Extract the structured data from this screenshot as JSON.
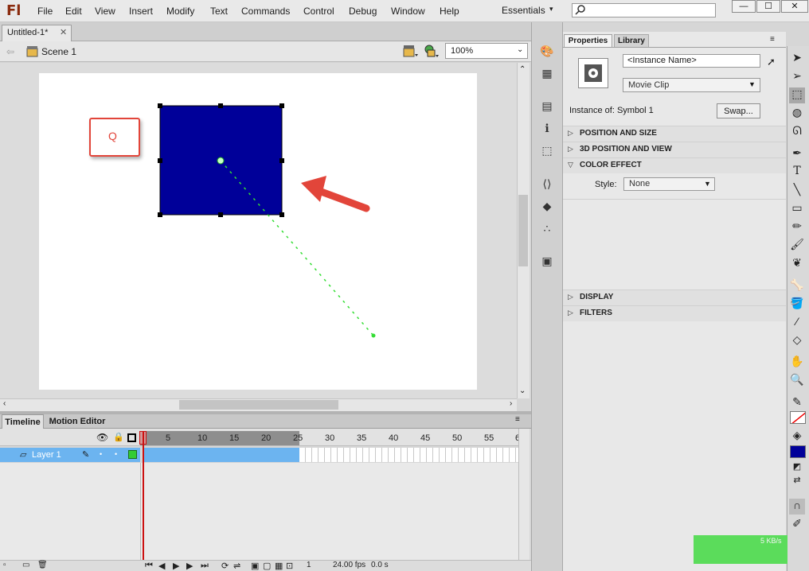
{
  "app": {
    "logo": "Fl"
  },
  "menu": [
    "File",
    "Edit",
    "View",
    "Insert",
    "Modify",
    "Text",
    "Commands",
    "Control",
    "Debug",
    "Window",
    "Help"
  ],
  "workspace": {
    "label": "Essentials"
  },
  "window_controls": {
    "minimize": "—",
    "maximize": "☐",
    "close": "✕"
  },
  "document": {
    "tab": "Untitled-1*",
    "scene": "Scene 1",
    "zoom": "100%"
  },
  "stage": {
    "annotation_letter": "Q",
    "symbol_color": "#000099",
    "motion_path_color": "#33dd33"
  },
  "timeline": {
    "tabs": [
      "Timeline",
      "Motion Editor"
    ],
    "ruler": [
      "5",
      "10",
      "15",
      "20",
      "25",
      "30",
      "35",
      "40",
      "45",
      "50",
      "55",
      "6"
    ],
    "layer": "Layer 1",
    "footer": {
      "frame": "1",
      "fps": "24.00 fps",
      "time": "0.0 s"
    }
  },
  "properties": {
    "tabs": [
      "Properties",
      "Library"
    ],
    "instance_name_placeholder": "<Instance Name>",
    "symbol_type": "Movie Clip",
    "instance_of_label": "Instance of:",
    "instance_of_value": "Symbol 1",
    "swap_button": "Swap...",
    "sections": {
      "position_size": "POSITION AND SIZE",
      "position_3d": "3D POSITION AND VIEW",
      "color_effect": "COLOR EFFECT",
      "display": "DISPLAY",
      "filters": "FILTERS"
    },
    "style_label": "Style:",
    "style_value": "None"
  },
  "status": {
    "net_speed": "5 KB/s"
  }
}
